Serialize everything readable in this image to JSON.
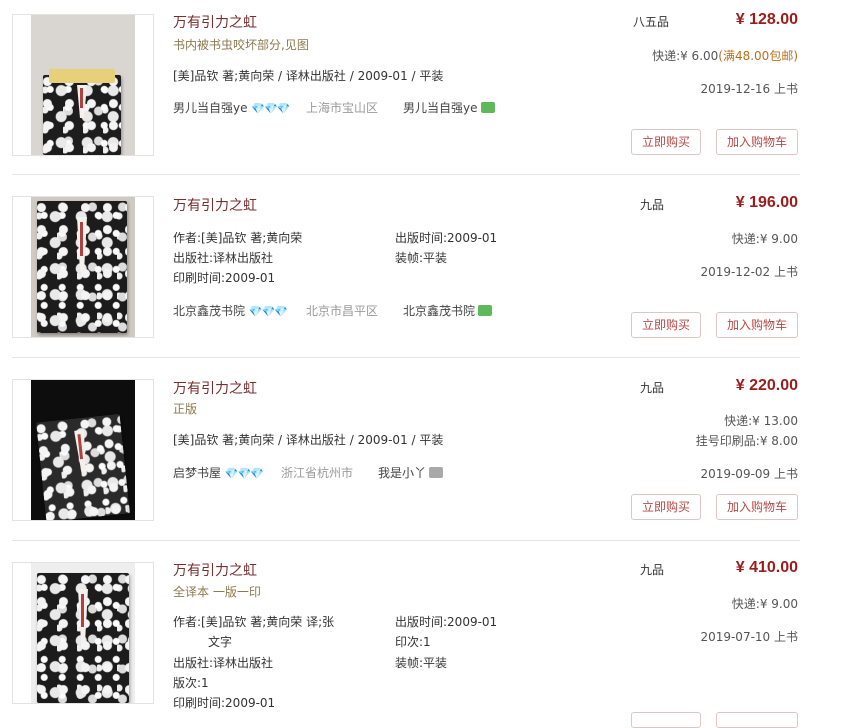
{
  "listings": [
    {
      "title": "万有引力之虹",
      "subtitle": "书内被书虫咬坏部分,见图",
      "meta_line": "[美]品钦 著;黄向荣  / 译林出版社 / 2009-01 / 平装",
      "seller": "男儿当自强ye",
      "region": "上海市宝山区",
      "contact": "男儿当自强ye",
      "condition": "八五品",
      "price": "¥ 128.00",
      "shipping": "快递:¥ 6.00",
      "shipping_promo": "(满48.00包邮)",
      "date": "2019-12-16 上书",
      "buy_label": "立即购买",
      "cart_label": "加入购物车"
    },
    {
      "title": "万有引力之虹",
      "author": "作者:[美]品钦 著;黄向荣",
      "publisher": "出版社:译林出版社",
      "print_time": "印刷时间:2009-01",
      "pub_time": "出版时间:2009-01",
      "binding": "装帧:平装",
      "seller": "北京鑫茂书院",
      "region": "北京市昌平区",
      "contact": "北京鑫茂书院",
      "condition": "九品",
      "price": "¥ 196.00",
      "shipping": "快递:¥ 9.00",
      "date": "2019-12-02 上书",
      "buy_label": "立即购买",
      "cart_label": "加入购物车"
    },
    {
      "title": "万有引力之虹",
      "subtitle": "正版",
      "meta_line": "[美]品钦 著;黄向荣  / 译林出版社 / 2009-01 / 平装",
      "seller": "启梦书屋",
      "region": "浙江省杭州市",
      "contact": "我是小丫",
      "condition": "九品",
      "price": "¥ 220.00",
      "shipping": "快递:¥ 13.00",
      "shipping2": "挂号印刷品:¥ 8.00",
      "date": "2019-09-09 上书",
      "buy_label": "立即购买",
      "cart_label": "加入购物车"
    },
    {
      "title": "万有引力之虹",
      "subtitle": "全译本 一版一印",
      "author": "作者:[美]品钦 著;黄向荣 译;张",
      "author_cont": "文字",
      "publisher": "出版社:译林出版社",
      "edition": "版次:1",
      "print_time": "印刷时间:2009-01",
      "pub_time": "出版时间:2009-01",
      "print_no": "印次:1",
      "binding": "装帧:平装",
      "condition": "九品",
      "price": "¥ 410.00",
      "shipping": "快递:¥ 9.00",
      "date": "2019-07-10 上书"
    }
  ],
  "gems": "💎💎💎",
  "colors": {
    "price": "#9b1c1c",
    "title": "#7a2e2e",
    "button_text": "#b64a47",
    "chat": "#5fb85a"
  },
  "icons": [
    "diamond-icon",
    "chat-icon"
  ]
}
